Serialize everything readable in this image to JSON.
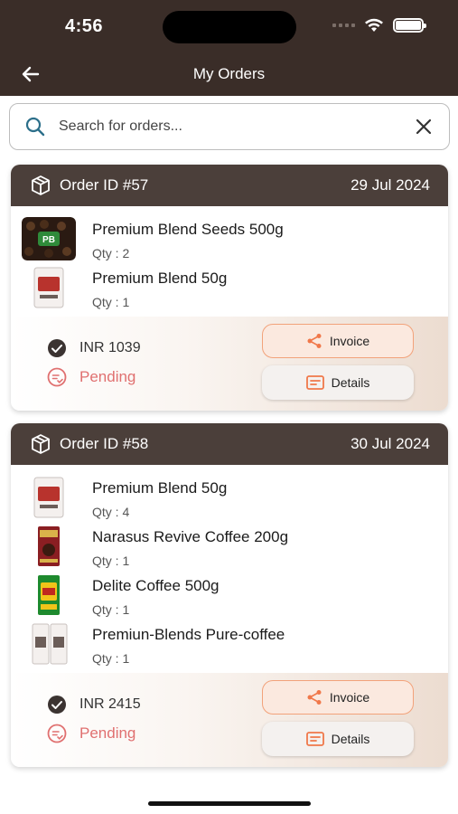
{
  "status_bar": {
    "time": "4:56"
  },
  "header": {
    "title": "My Orders"
  },
  "search": {
    "placeholder": "Search for orders..."
  },
  "orders": [
    {
      "order_id": "Order ID #57",
      "date": "29 Jul 2024",
      "items": [
        {
          "name": "Premium Blend Seeds 500g",
          "qty": "Qty : 2"
        },
        {
          "name": "Premium Blend 50g",
          "qty": "Qty : 1"
        }
      ],
      "amount": "INR 1039",
      "status": "Pending",
      "invoice_label": "Invoice",
      "details_label": "Details"
    },
    {
      "order_id": "Order ID #58",
      "date": "30 Jul 2024",
      "items": [
        {
          "name": "Premium Blend 50g",
          "qty": "Qty : 4"
        },
        {
          "name": "Narasus Revive Coffee 200g",
          "qty": "Qty : 1"
        },
        {
          "name": "Delite Coffee 500g",
          "qty": "Qty : 1"
        },
        {
          "name": "Premiun-Blends Pure-coffee",
          "qty": "Qty : 1"
        }
      ],
      "amount": "INR 2415",
      "status": "Pending",
      "invoice_label": "Invoice",
      "details_label": "Details"
    }
  ],
  "colors": {
    "header_bg": "#3a2d28",
    "card_head_bg": "#4b3f3a",
    "accent": "#f0784a",
    "pending": "#e07070"
  }
}
